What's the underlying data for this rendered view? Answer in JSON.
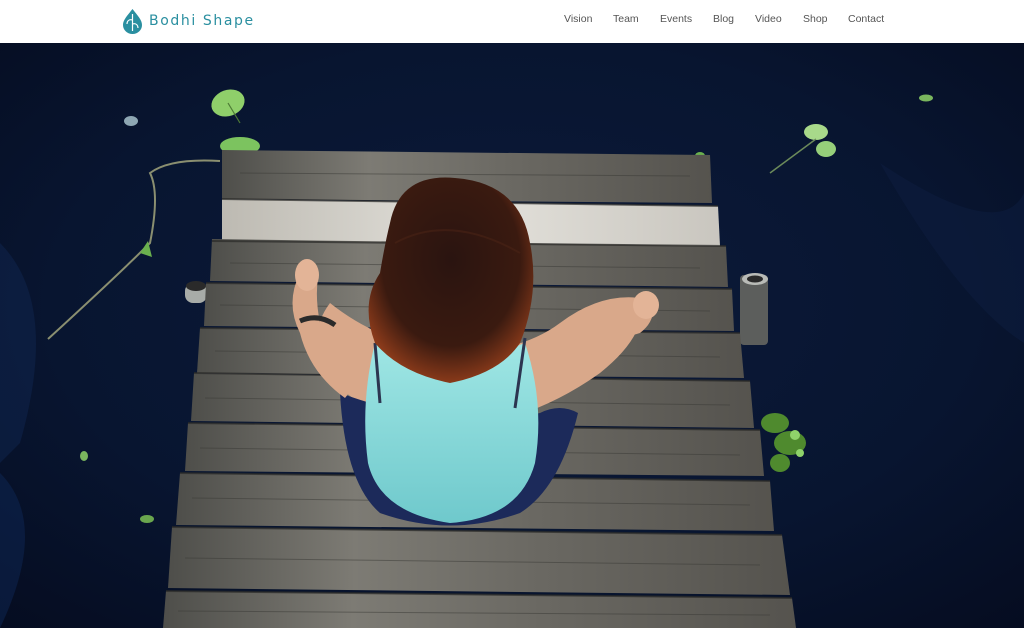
{
  "brand": {
    "name": "Bodhi Shape",
    "accent_color": "#2a8fa0",
    "logo_icon": "leaf-drop-icon"
  },
  "nav": {
    "items": [
      {
        "label": "Vision"
      },
      {
        "label": "Team"
      },
      {
        "label": "Events"
      },
      {
        "label": "Blog"
      },
      {
        "label": "Video"
      },
      {
        "label": "Shop"
      },
      {
        "label": "Contact"
      }
    ]
  },
  "hero": {
    "image": "woman-meditating-on-wooden-dock-photo"
  }
}
